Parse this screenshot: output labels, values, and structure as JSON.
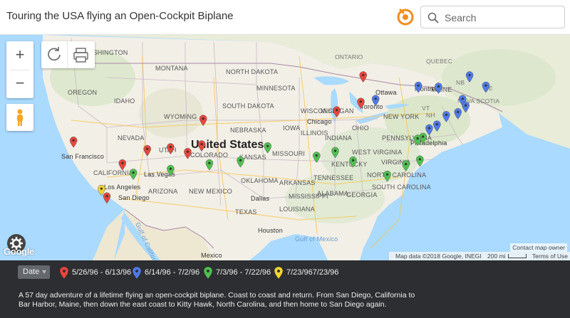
{
  "header": {
    "title": "Touring the USA flying an Open-Cockpit Biplane",
    "search_placeholder": "Search",
    "logo_icon": "circle-logo-icon",
    "accent_color": "#f28c1c"
  },
  "map": {
    "country_label": "United States",
    "labels": {
      "states": [
        "WASHINGTON",
        "MONTANA",
        "NORTH DAKOTA",
        "MINNESOTA",
        "OREGON",
        "IDAHO",
        "SOUTH DAKOTA",
        "WISCONSIN",
        "WYOMING",
        "IOWA",
        "NEBRASKA",
        "NEVADA",
        "UTAH",
        "COLORADO",
        "KANSAS",
        "MISSOURI",
        "ILLINOIS",
        "INDIANA",
        "OHIO",
        "CALIFORNIA",
        "ARIZONA",
        "NEW MEXICO",
        "OKLAHOMA",
        "ARKANSAS",
        "TENNESSEE",
        "TEXAS",
        "LOUISIANA",
        "KENTUCKY",
        "NORTH CAROLINA",
        "SOUTH CAROLINA",
        "GEORGIA",
        "ALABAMA",
        "MISSISSIPPI",
        "PENNSYLVANIA",
        "NEW YORK",
        "VIRGINIA",
        "WEST VIRGINIA",
        "MICHIGAN",
        "MAINE",
        "NOVA SCOTIA",
        "ONTARIO",
        "QUEBEC",
        "NB",
        "PE",
        "VT",
        "NH"
      ],
      "cities": [
        "San Francisco",
        "Las Vegas",
        "Los Angeles",
        "San Diego",
        "Chicago",
        "Toronto",
        "Ottawa",
        "Montreal",
        "Philadelphia",
        "Dallas",
        "Houston",
        "Mexico"
      ],
      "water": [
        "Gulf of California",
        "Gulf of Mexico"
      ]
    },
    "attribution": {
      "owner": "Contact map owner",
      "data": "Map data ©2018 Google, INEGI",
      "scale": "200 mi",
      "terms": "Terms of Use"
    },
    "google_text": "Google",
    "controls": {
      "zoom_in": "+",
      "zoom_out": "−"
    },
    "markers": [
      {
        "leg": 1,
        "lon": -117.2,
        "lat": 32.7
      },
      {
        "leg": 1,
        "lon": -115.2,
        "lat": 36.2
      },
      {
        "leg": 1,
        "lon": -112.0,
        "lat": 37.7
      },
      {
        "leg": 1,
        "lon": -109.0,
        "lat": 37.9
      },
      {
        "leg": 1,
        "lon": -106.8,
        "lat": 37.4
      },
      {
        "leg": 1,
        "lon": -105.0,
        "lat": 38.2
      },
      {
        "leg": 1,
        "lon": -104.8,
        "lat": 40.9
      },
      {
        "leg": 1,
        "lon": -87.6,
        "lat": 41.8
      },
      {
        "leg": 1,
        "lon": -84.5,
        "lat": 42.7
      },
      {
        "leg": 1,
        "lon": -84.2,
        "lat": 45.5
      },
      {
        "leg": 1,
        "lon": -121.5,
        "lat": 38.6
      },
      {
        "leg": 2,
        "lon": -82.6,
        "lat": 43.0
      },
      {
        "leg": 2,
        "lon": -77.1,
        "lat": 44.4
      },
      {
        "leg": 2,
        "lon": -74.5,
        "lat": 44.3
      },
      {
        "leg": 2,
        "lon": -70.5,
        "lat": 45.5
      },
      {
        "leg": 2,
        "lon": -68.4,
        "lat": 44.4
      },
      {
        "leg": 2,
        "lon": -71.4,
        "lat": 43.0
      },
      {
        "leg": 2,
        "lon": -71.0,
        "lat": 42.3
      },
      {
        "leg": 2,
        "lon": -72.0,
        "lat": 41.6
      },
      {
        "leg": 2,
        "lon": -73.5,
        "lat": 41.3
      },
      {
        "leg": 2,
        "lon": -74.7,
        "lat": 40.3
      },
      {
        "leg": 2,
        "lon": -75.7,
        "lat": 39.9
      },
      {
        "leg": 3,
        "lon": -76.5,
        "lat": 39.0
      },
      {
        "leg": 3,
        "lon": -77.2,
        "lat": 38.8
      },
      {
        "leg": 3,
        "lon": -76.9,
        "lat": 36.6
      },
      {
        "leg": 3,
        "lon": -78.7,
        "lat": 36.1
      },
      {
        "leg": 3,
        "lon": -81.1,
        "lat": 35.0
      },
      {
        "leg": 3,
        "lon": -85.5,
        "lat": 36.5
      },
      {
        "leg": 3,
        "lon": -87.8,
        "lat": 37.5
      },
      {
        "leg": 3,
        "lon": -90.2,
        "lat": 37.0
      },
      {
        "leg": 3,
        "lon": -96.5,
        "lat": 38.0
      },
      {
        "leg": 3,
        "lon": -100.0,
        "lat": 36.5
      },
      {
        "leg": 3,
        "lon": -104.0,
        "lat": 36.2
      },
      {
        "leg": 3,
        "lon": -109.0,
        "lat": 35.6
      },
      {
        "leg": 3,
        "lon": -113.8,
        "lat": 35.2
      },
      {
        "leg": 4,
        "lon": -117.9,
        "lat": 33.5
      }
    ]
  },
  "legend": {
    "filter_label": "Date",
    "items": [
      {
        "label": "5/26/96 - 6/13/96",
        "color": "#e8453c"
      },
      {
        "label": "6/14/96 - 7/2/96",
        "color": "#4f7ae8"
      },
      {
        "label": "7/3/96 - 7/22/96",
        "color": "#4fc04f"
      },
      {
        "label": "7/23/967/23/96",
        "color": "#f2d433"
      }
    ]
  },
  "description": "A 57 day adventure of a lifetime flying an open-cockpit biplane. Coast to coast and return. From San Diego, California to Bar Harbor, Maine, then down the east coast to Kitty Hawk, North Carolina, and then home to San Diego again."
}
